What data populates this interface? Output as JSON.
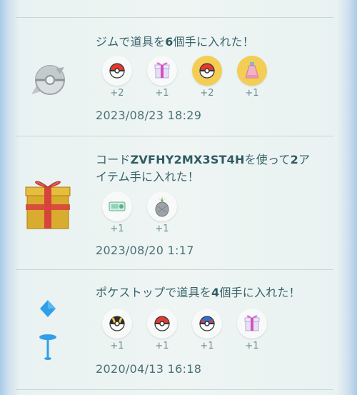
{
  "entries": [
    {
      "title_parts": [
        "ジムで道具を",
        "6",
        "個手に入れた！"
      ],
      "source": "gym-icon",
      "items": [
        {
          "icon": "poke-ball-icon",
          "count": "+2",
          "highlight": false
        },
        {
          "icon": "gift-icon",
          "count": "+1",
          "highlight": false
        },
        {
          "icon": "poke-ball-icon",
          "count": "+2",
          "highlight": true
        },
        {
          "icon": "potion-icon",
          "count": "+1",
          "highlight": true
        }
      ],
      "date": "2023/08/23 18:29"
    },
    {
      "title_line1_parts": [
        "コード",
        "ZVFHY2MX3ST4H",
        "を使って",
        "2",
        "ア"
      ],
      "title_line2": "イテム手に入れた！",
      "source": "gift-box-icon",
      "items": [
        {
          "icon": "raid-pass-icon",
          "count": "+1",
          "highlight": false
        },
        {
          "icon": "pinap-berry-icon",
          "count": "+1",
          "highlight": false
        }
      ],
      "date": "2023/08/20 1:17"
    },
    {
      "title_parts": [
        "ポケストップで道具を",
        "4",
        "個手に入れた！"
      ],
      "source": "pokestop-icon",
      "items": [
        {
          "icon": "ultra-ball-icon",
          "count": "+1",
          "highlight": false
        },
        {
          "icon": "poke-ball-icon",
          "count": "+1",
          "highlight": false
        },
        {
          "icon": "great-ball-icon",
          "count": "+1",
          "highlight": false
        },
        {
          "icon": "gift-icon",
          "count": "+1",
          "highlight": false
        }
      ],
      "date": "2020/04/13 16:18"
    }
  ]
}
